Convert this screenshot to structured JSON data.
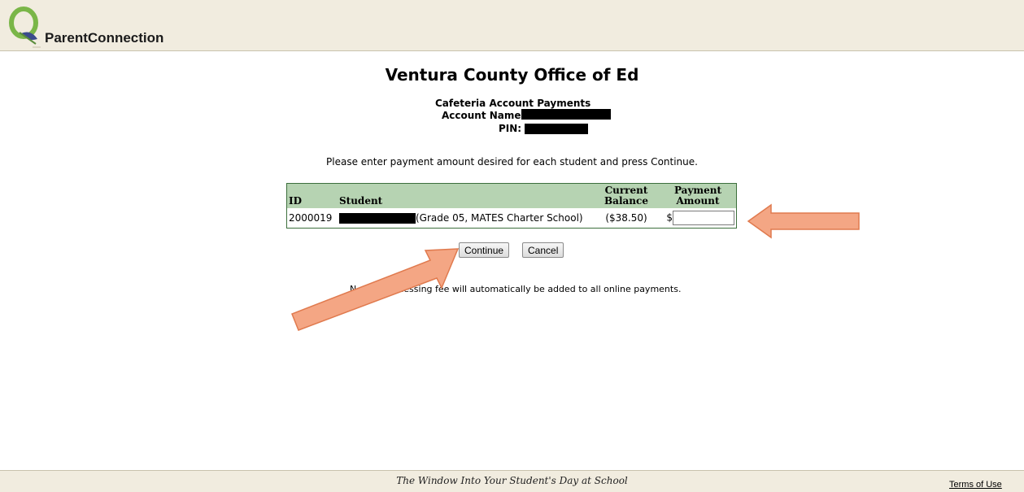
{
  "header": {
    "logo_text": "ParentConnection"
  },
  "page": {
    "title": "Ventura County Office of Ed",
    "section_title": "Cafeteria Account Payments",
    "account_name_label": "Account Name:",
    "pin_label": "PIN:",
    "instructions": "Please enter payment amount desired for each student and press Continue."
  },
  "table": {
    "headers": {
      "id": "ID",
      "student": "Student",
      "balance_line1": "Current",
      "balance_line2": "Balance",
      "payment_line1": "Payment",
      "payment_line2": "Amount"
    },
    "rows": [
      {
        "id": "2000019",
        "student_detail": "(Grade 05, MATES Charter School)",
        "balance": "($38.50)",
        "currency": "$",
        "amount_value": ""
      }
    ]
  },
  "buttons": {
    "continue_label": "Continue",
    "cancel_label": "Cancel"
  },
  "note": {
    "start": "N",
    "end": "cessing fee will automatically be added to all online payments."
  },
  "footer": {
    "tagline": "The Window Into Your Student's Day at School",
    "terms_label": "Terms of Use"
  },
  "colors": {
    "header_bg": "#f1ecdf",
    "table_header_bg": "#b6d3b2",
    "table_border": "#3c6f3c",
    "arrow_fill": "#f4a684",
    "arrow_stroke": "#e07a4e"
  }
}
